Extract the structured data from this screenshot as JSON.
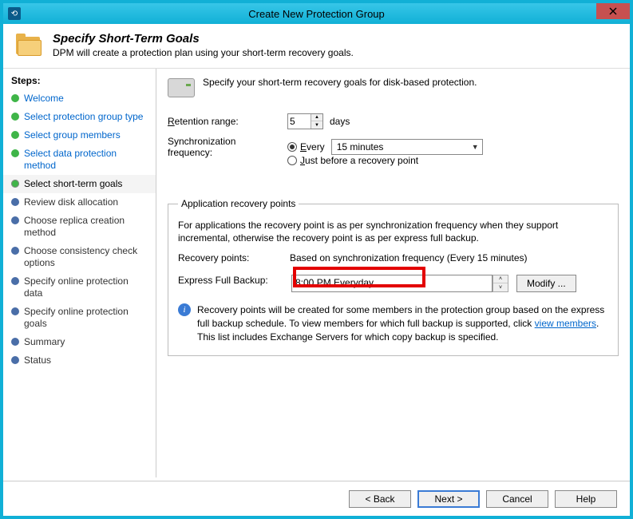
{
  "window": {
    "title": "Create New Protection Group"
  },
  "header": {
    "title": "Specify Short-Term Goals",
    "subtitle": "DPM will create a protection plan using your short-term recovery goals."
  },
  "sidebar": {
    "label": "Steps:",
    "items": [
      {
        "label": "Welcome",
        "state": "done"
      },
      {
        "label": "Select protection group type",
        "state": "done"
      },
      {
        "label": "Select group members",
        "state": "done"
      },
      {
        "label": "Select data protection method",
        "state": "done"
      },
      {
        "label": "Select short-term goals",
        "state": "current"
      },
      {
        "label": "Review disk allocation",
        "state": "pending"
      },
      {
        "label": "Choose replica creation method",
        "state": "pending"
      },
      {
        "label": "Choose consistency check options",
        "state": "pending"
      },
      {
        "label": "Specify online protection data",
        "state": "pending"
      },
      {
        "label": "Specify online protection goals",
        "state": "pending"
      },
      {
        "label": "Summary",
        "state": "pending"
      },
      {
        "label": "Status",
        "state": "pending"
      }
    ]
  },
  "main": {
    "intro": "Specify your short-term recovery goals for disk-based protection.",
    "retention_label": "Retention range:",
    "retention_value": "5",
    "retention_unit": "days",
    "syncfreq_label": "Synchronization frequency:",
    "sync_every_label": "Every",
    "sync_every_value": "15 minutes",
    "sync_justbefore_label": "Just before a recovery point",
    "group_legend": "Application recovery points",
    "group_desc": "For applications the recovery point is as per synchronization frequency when they support incremental, otherwise the recovery point is as per express full backup.",
    "recpoints_label": "Recovery points:",
    "recpoints_value": "Based on synchronization frequency (Every 15 minutes)",
    "efb_label": "Express Full Backup:",
    "efb_value": "8:00 PM Everyday",
    "modify_btn": "Modify ...",
    "info_text_1": "Recovery points will be created for some members in the protection group based on the express full backup schedule. To view members for which full backup is supported, click ",
    "info_link": "view members",
    "info_text_2": ". This list includes Exchange Servers for which copy backup is specified."
  },
  "footer": {
    "back": "< Back",
    "next": "Next >",
    "cancel": "Cancel",
    "help": "Help"
  }
}
